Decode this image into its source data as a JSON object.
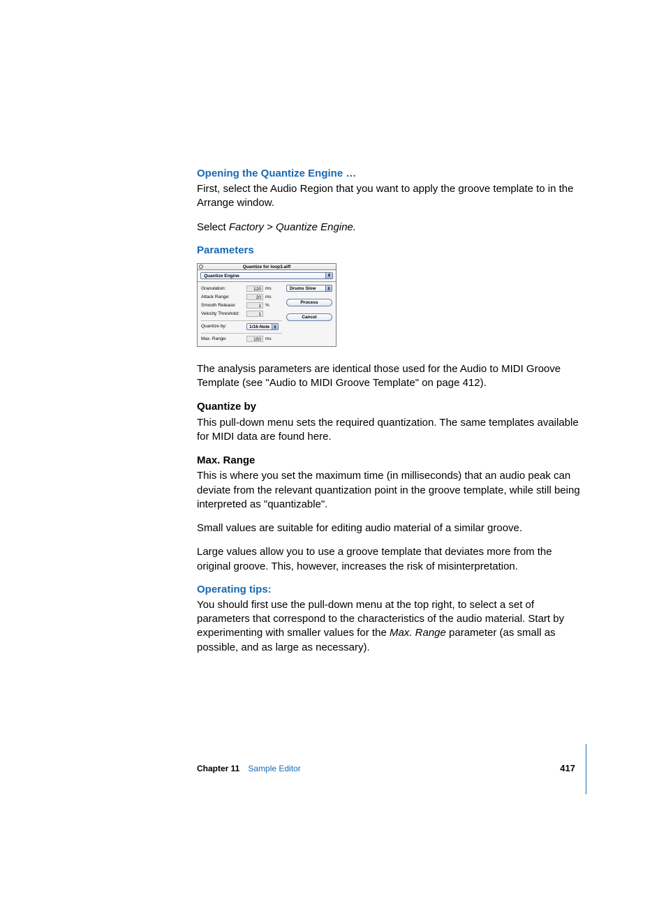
{
  "headings": {
    "opening": "Opening the Quantize Engine …",
    "parameters": "Parameters",
    "operating": "Operating tips:"
  },
  "paragraphs": {
    "opening_body": "First, select the Audio Region that you want to apply the groove template to in the Arrange window.",
    "select_prefix": "Select ",
    "select_italic": "Factory > Quantize Engine.",
    "analysis_body": "The analysis parameters are identical those used for the Audio to MIDI Groove Template (see \"Audio to MIDI Groove Template\" on page 412).",
    "qby_label": "Quantize by",
    "qby_body": "This pull-down menu sets the required quantization. The same templates available for MIDI data are found here.",
    "max_label": "Max. Range",
    "max_body": "This is where you set the maximum time (in milliseconds) that an audio peak can deviate from the relevant quantization point in the groove template, while still being interpreted as \"quantizable\".",
    "small_body": "Small values are suitable for editing audio material of a similar groove.",
    "large_body": "Large values allow you to use a groove template that deviates more from the original groove. This, however, increases the risk of misinterpretation.",
    "tips_prefix": "You should first use the pull-down menu at the top right, to select a set of parameters that correspond to the characteristics of the audio material. Start by experimenting with smaller values for the ",
    "tips_italic": "Max. Range",
    "tips_suffix": " parameter (as small as possible, and as large as necessary)."
  },
  "dialog": {
    "title": "Quantize for loop3.aiff",
    "engine_label": "Quantize Engine",
    "preset": "Drums Slow",
    "process": "Process",
    "cancel": "Cancel",
    "fields": {
      "granulation": {
        "label": "Granulation:",
        "value": "120",
        "unit": "ms"
      },
      "attack": {
        "label": "Attack Range:",
        "value": "20",
        "unit": "ms"
      },
      "smooth": {
        "label": "Smooth Release:",
        "value": "1",
        "unit": "%"
      },
      "velocity": {
        "label": "Velocity Threshold:",
        "value": "1",
        "unit": ""
      },
      "quantize_by": {
        "label": "Quantize by:",
        "value": "1/16-Note"
      },
      "max_range": {
        "label": "Max. Range:",
        "value": "150",
        "unit": "ms"
      }
    }
  },
  "footer": {
    "chapter_label": "Chapter 11",
    "chapter_name": "Sample Editor",
    "page_number": "417"
  }
}
